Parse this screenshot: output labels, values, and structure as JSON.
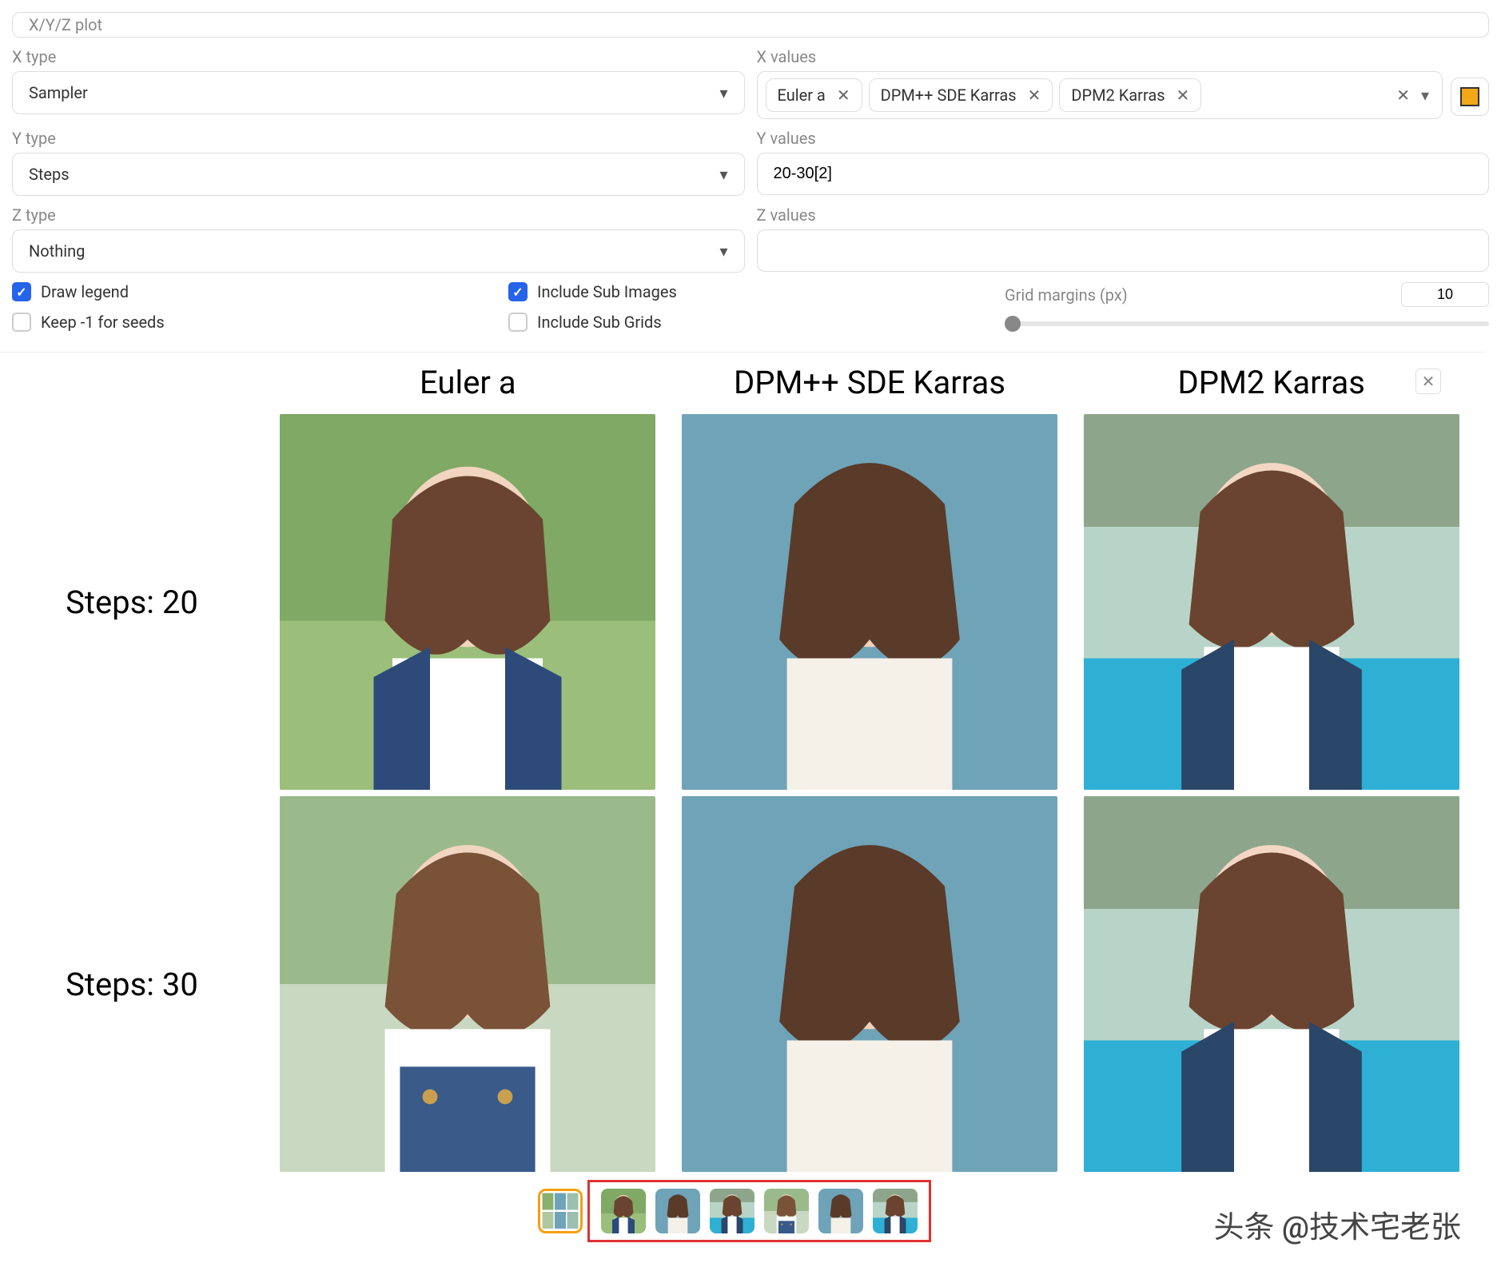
{
  "script": {
    "title": "X/Y/Z plot"
  },
  "axes": {
    "x": {
      "type_label": "X type",
      "type_value": "Sampler",
      "values_label": "X values",
      "chips": [
        "Euler a",
        "DPM++ SDE Karras",
        "DPM2 Karras"
      ]
    },
    "y": {
      "type_label": "Y type",
      "type_value": "Steps",
      "values_label": "Y values",
      "values": "20-30[2]"
    },
    "z": {
      "type_label": "Z type",
      "type_value": "Nothing",
      "values_label": "Z values",
      "values": ""
    }
  },
  "options": {
    "draw_legend": "Draw legend",
    "keep_seeds": "Keep -1 for seeds",
    "include_sub_images": "Include Sub Images",
    "include_sub_grids": "Include Sub Grids",
    "grid_margins_label": "Grid margins (px)",
    "grid_margins_value": "10",
    "checked": {
      "draw_legend": true,
      "keep_seeds": false,
      "include_sub_images": true,
      "include_sub_grids": false
    }
  },
  "result": {
    "col_headers": [
      "Euler a",
      "DPM++ SDE Karras",
      "DPM2 Karras"
    ],
    "row_headers": [
      "Steps: 20",
      "Steps: 30"
    ]
  },
  "watermark": "头条 @技术宅老张"
}
